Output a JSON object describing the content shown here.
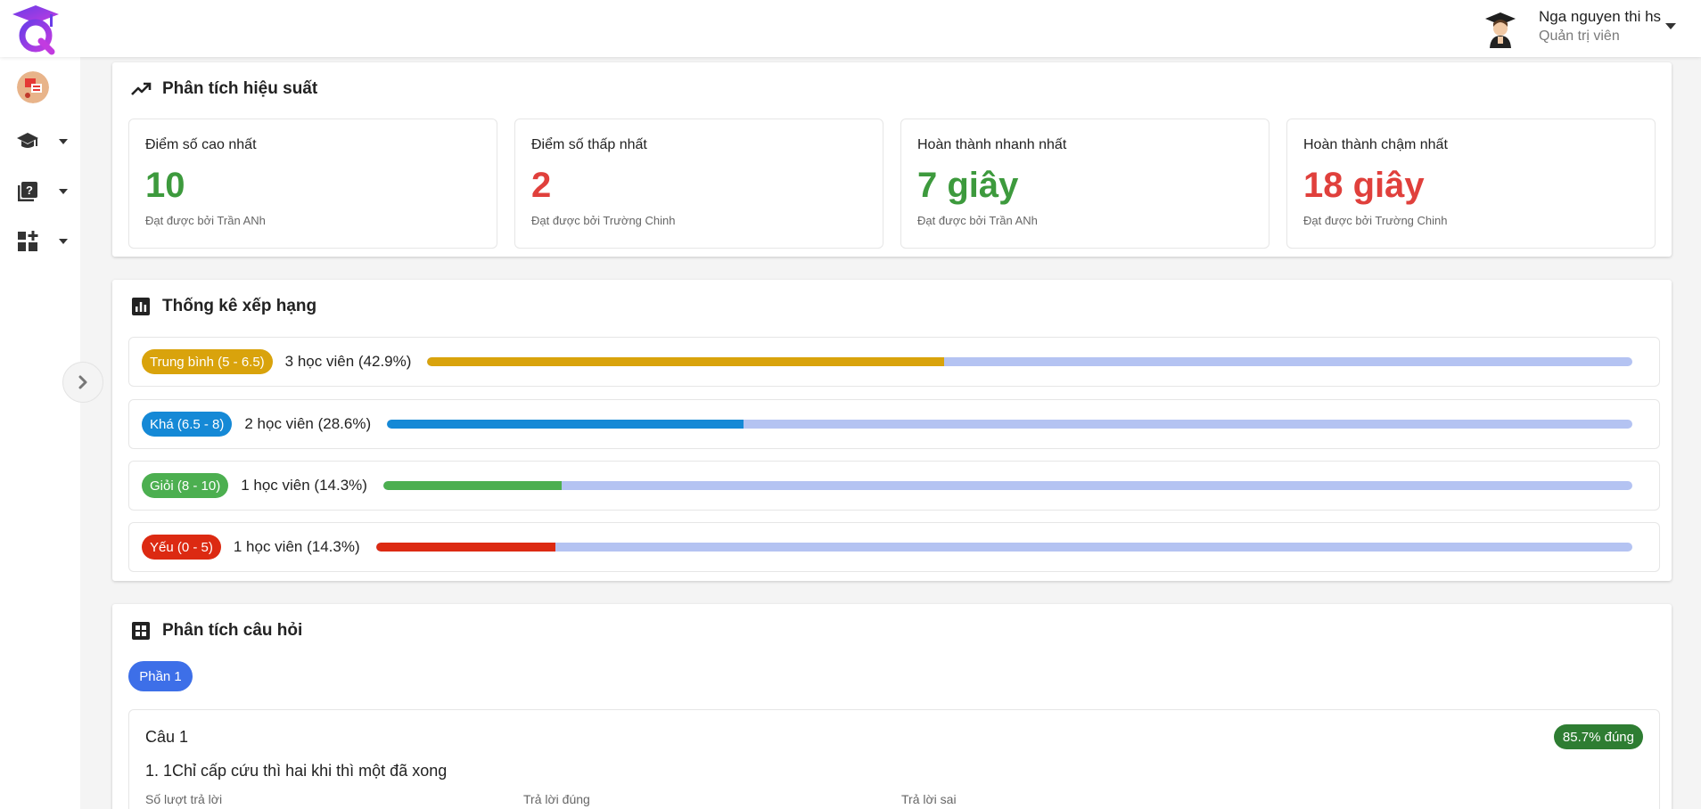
{
  "header": {
    "user_name": "Nga nguyen thi hs",
    "user_role": "Quản trị viên"
  },
  "sidebar": {
    "items": [
      {
        "name": "courses",
        "icon": "graduation-cap-icon"
      },
      {
        "name": "questions",
        "icon": "question-book-icon"
      },
      {
        "name": "dashboard",
        "icon": "dashboard-add-icon"
      }
    ]
  },
  "performance": {
    "title": "Phân tích hiệu suất",
    "metrics": [
      {
        "label": "Điểm số cao nhất",
        "value": "10",
        "sub": "Đạt được bởi Trần ANh",
        "color": "#3d9a3d"
      },
      {
        "label": "Điểm số thấp nhất",
        "value": "2",
        "sub": "Đạt được bởi Trường Chinh",
        "color": "#e0403c"
      },
      {
        "label": "Hoàn thành nhanh nhất",
        "value": "7 giây",
        "sub": "Đạt được bởi Trần ANh",
        "color": "#3d9a3d"
      },
      {
        "label": "Hoàn thành chậm nhất",
        "value": "18 giây",
        "sub": "Đạt được bởi Trường Chinh",
        "color": "#e0403c"
      }
    ]
  },
  "ranking": {
    "title": "Thống kê xếp hạng",
    "rows": [
      {
        "badge": "Trung bình (5 - 6.5)",
        "text": "3 học viên (42.9%)",
        "percent": 42.9,
        "color": "#d9a30c"
      },
      {
        "badge": "Khá (6.5 - 8)",
        "text": "2 học viên (28.6%)",
        "percent": 28.6,
        "color": "#1589d6"
      },
      {
        "badge": "Giỏi (8 - 10)",
        "text": "1 học viên (14.3%)",
        "percent": 14.3,
        "color": "#4caf50"
      },
      {
        "badge": "Yếu (0 - 5)",
        "text": "1 học viên (14.3%)",
        "percent": 14.3,
        "color": "#dc2a12"
      }
    ],
    "track_color": "#b4c3f2"
  },
  "questions": {
    "title": "Phân tích câu hỏi",
    "part_label": "Phần 1",
    "question": {
      "number": "Câu 1",
      "text": "1. 1Chỉ cấp cứu thì hai khi thì một đã xong",
      "correct_badge": "85.7% đúng",
      "stat_labels": [
        "Số lượt trả lời",
        "Trả lời đúng",
        "Trả lời sai"
      ]
    }
  }
}
